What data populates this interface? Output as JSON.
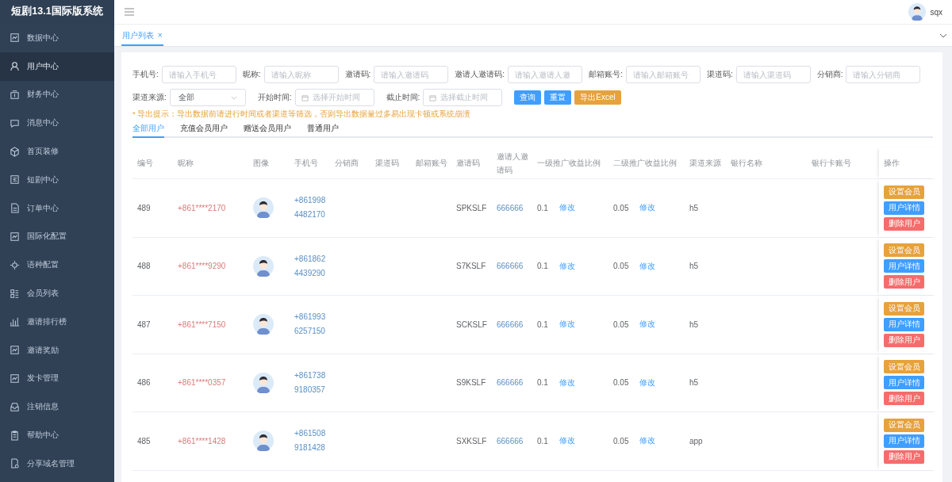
{
  "app_title": "短剧13.1国际版系统",
  "sidebar": {
    "items": [
      {
        "label": "数据中心",
        "selected": false
      },
      {
        "label": "用户中心",
        "selected": true
      },
      {
        "label": "财务中心",
        "selected": false
      },
      {
        "label": "消息中心",
        "selected": false
      },
      {
        "label": "首页装修",
        "selected": false
      },
      {
        "label": "短剧中心",
        "selected": false
      },
      {
        "label": "订单中心",
        "selected": false
      },
      {
        "label": "国际化配置",
        "selected": false
      },
      {
        "label": "语种配置",
        "selected": false
      },
      {
        "label": "会员列表",
        "selected": false
      },
      {
        "label": "邀请排行榜",
        "selected": false
      },
      {
        "label": "邀请奖励",
        "selected": false
      },
      {
        "label": "发卡管理",
        "selected": false
      },
      {
        "label": "注销信息",
        "selected": false
      },
      {
        "label": "帮助中心",
        "selected": false
      },
      {
        "label": "分享域名管理",
        "selected": false
      }
    ]
  },
  "header": {
    "user": "sqx"
  },
  "page_tabs": [
    {
      "label": "用户列表",
      "close": "×",
      "selected": true
    }
  ],
  "filters": [
    {
      "label": "手机号:",
      "placeholder": "请输入手机号"
    },
    {
      "label": "昵称:",
      "placeholder": "请输入昵称"
    },
    {
      "label": "邀请码:",
      "placeholder": "请输入邀请码"
    },
    {
      "label": "邀请人邀请码:",
      "placeholder": "请输入邀请人邀"
    },
    {
      "label": "邮箱账号:",
      "placeholder": "请输入邮箱账号"
    },
    {
      "label": "渠道码:",
      "placeholder": "请输入渠道码"
    },
    {
      "label": "分销商:",
      "placeholder": "请输入分销商"
    }
  ],
  "filters_row2": [
    {
      "kind": "select",
      "label": "渠道来源:",
      "value": "全部"
    },
    {
      "kind": "date",
      "label": "开始时间:",
      "placeholder": "选择开始时间"
    },
    {
      "kind": "date",
      "label": "截止时间:",
      "placeholder": "选择截止时间"
    }
  ],
  "buttons": [
    {
      "label": "查询",
      "kind": "primary"
    },
    {
      "label": "重置",
      "kind": "primary"
    },
    {
      "label": "导出Excel",
      "kind": "warning"
    }
  ],
  "export_hint": "* 导出提示：导出数据前请进行时间或者渠道等筛选，否则导出数据量过多易出现卡顿或系统崩溃",
  "user_tabs": [
    {
      "label": "全部用户",
      "selected": true
    },
    {
      "label": "充值会员用户",
      "selected": false
    },
    {
      "label": "赠送会员用户",
      "selected": false
    },
    {
      "label": "普通用户",
      "selected": false
    }
  ],
  "table": {
    "columns": [
      "编号",
      "昵称",
      "图像",
      "手机号",
      "分销商",
      "渠道码",
      "邮箱账号",
      "邀请码",
      "邀请人邀请码",
      "一级推广收益比例",
      "二级推广收益比例",
      "渠道来源",
      "银行名称",
      "银行卡账号",
      "操作"
    ],
    "rows": [
      {
        "id": "489",
        "nickname": "+861****2170",
        "phone": "+8619984482170",
        "invite_code": "SPKSLF",
        "inviter_code": "666666",
        "rate1": "0.1",
        "rate1_edit": "修改",
        "rate2": "0.05",
        "rate2_edit": "修改",
        "channel": "h5",
        "actions": [
          {
            "label": "设置会员",
            "kind": "warning"
          },
          {
            "label": "用户详情",
            "kind": "primary"
          },
          {
            "label": "删除用户",
            "kind": "danger"
          }
        ]
      },
      {
        "id": "488",
        "nickname": "+861****9290",
        "phone": "+8618624439290",
        "invite_code": "S7KSLF",
        "inviter_code": "666666",
        "rate1": "0.1",
        "rate1_edit": "修改",
        "rate2": "0.05",
        "rate2_edit": "修改",
        "channel": "h5",
        "actions": [
          {
            "label": "设置会员",
            "kind": "warning"
          },
          {
            "label": "用户详情",
            "kind": "primary"
          },
          {
            "label": "删除用户",
            "kind": "danger"
          }
        ]
      },
      {
        "id": "487",
        "nickname": "+861****7150",
        "phone": "+8619936257150",
        "invite_code": "SCKSLF",
        "inviter_code": "666666",
        "rate1": "0.1",
        "rate1_edit": "修改",
        "rate2": "0.05",
        "rate2_edit": "修改",
        "channel": "h5",
        "actions": [
          {
            "label": "设置会员",
            "kind": "warning"
          },
          {
            "label": "用户详情",
            "kind": "primary"
          },
          {
            "label": "删除用户",
            "kind": "danger"
          }
        ]
      },
      {
        "id": "486",
        "nickname": "+861****0357",
        "phone": "+8617389180357",
        "invite_code": "S9KSLF",
        "inviter_code": "666666",
        "rate1": "0.1",
        "rate1_edit": "修改",
        "rate2": "0.05",
        "rate2_edit": "修改",
        "channel": "h5",
        "actions": [
          {
            "label": "设置会员",
            "kind": "warning"
          },
          {
            "label": "用户详情",
            "kind": "primary"
          },
          {
            "label": "删除用户",
            "kind": "danger"
          }
        ]
      },
      {
        "id": "485",
        "nickname": "+861****1428",
        "phone": "+8615089181428",
        "invite_code": "SXKSLF",
        "inviter_code": "666666",
        "rate1": "0.1",
        "rate1_edit": "修改",
        "rate2": "0.05",
        "rate2_edit": "修改",
        "channel": "app",
        "actions": [
          {
            "label": "设置会员",
            "kind": "warning"
          },
          {
            "label": "用户详情",
            "kind": "primary"
          },
          {
            "label": "删除用户",
            "kind": "danger"
          }
        ]
      }
    ]
  }
}
